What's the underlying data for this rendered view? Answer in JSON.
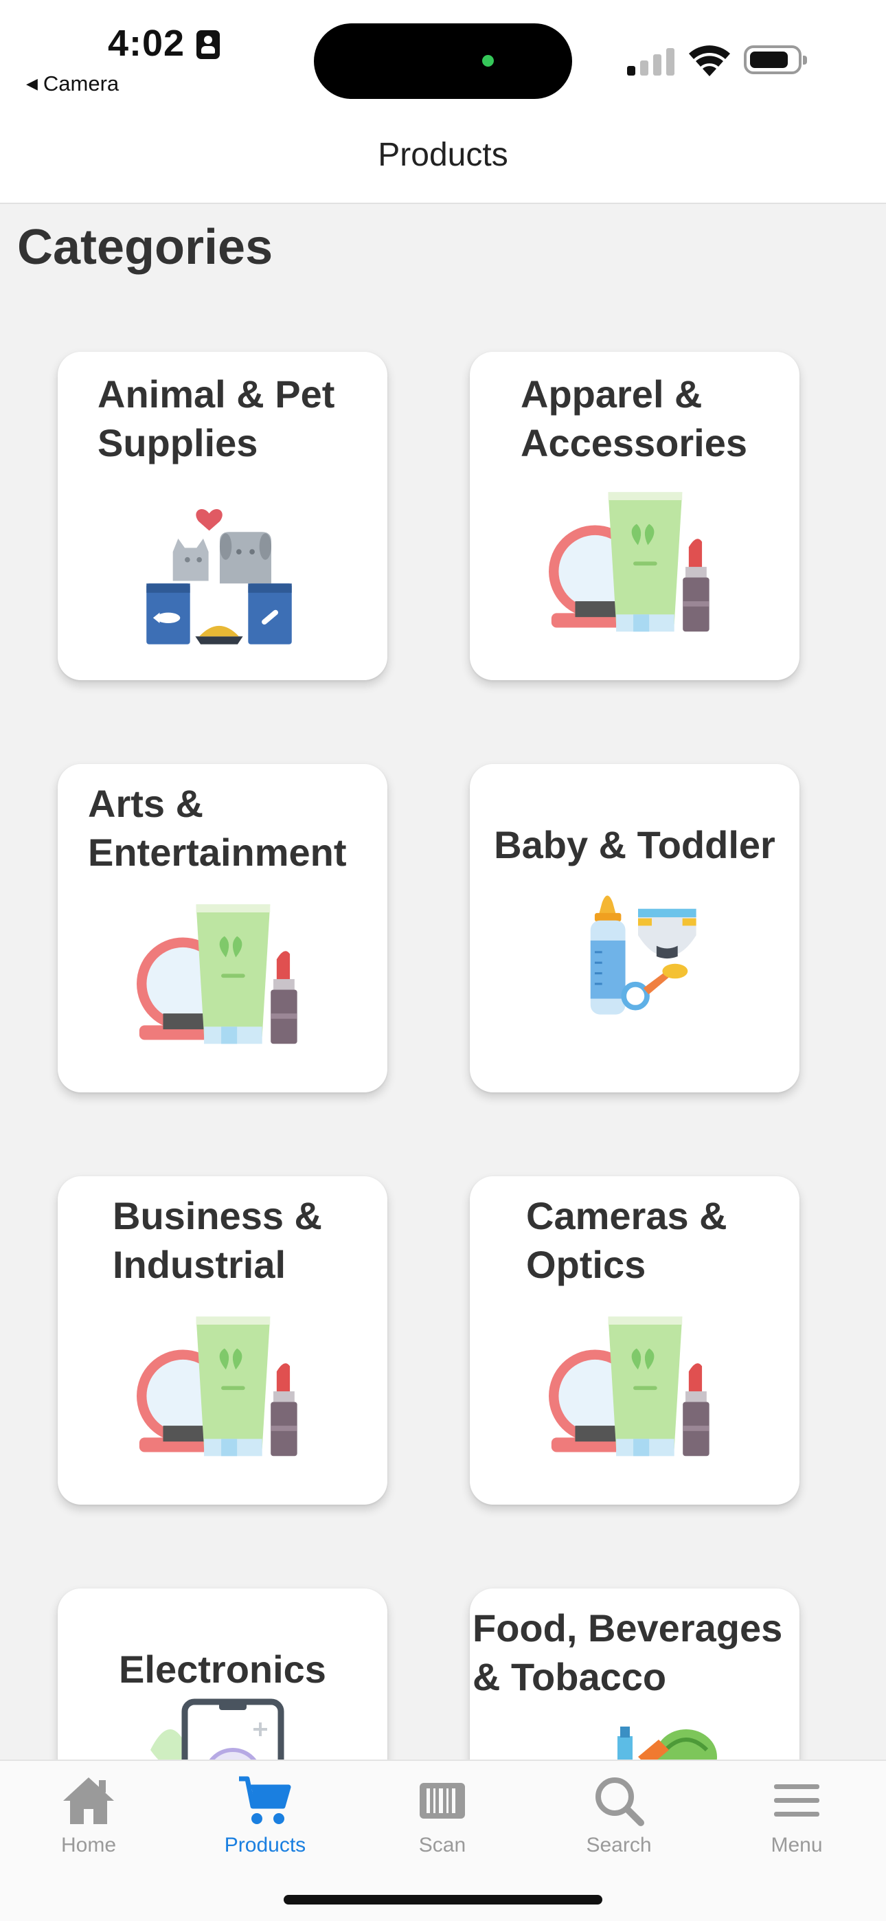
{
  "status_bar": {
    "time": "4:02",
    "back_app": "Camera"
  },
  "nav": {
    "title": "Products"
  },
  "section": {
    "title": "Categories"
  },
  "categories": [
    {
      "label": "Animal & Pet\nSupplies",
      "icon": "pet-supplies-icon"
    },
    {
      "label": "Apparel &\nAccessories",
      "icon": "cosmetics-icon"
    },
    {
      "label": "Arts &\nEntertainment",
      "icon": "cosmetics-icon"
    },
    {
      "label": "Baby & Toddler",
      "icon": "baby-items-icon"
    },
    {
      "label": "Business &\nIndustrial",
      "icon": "cosmetics-icon"
    },
    {
      "label": "Cameras &\nOptics",
      "icon": "cosmetics-icon"
    },
    {
      "label": "Electronics",
      "icon": "electronics-icon"
    },
    {
      "label": "Food, Beverages\n& Tobacco",
      "icon": "groceries-icon"
    }
  ],
  "tabs": [
    {
      "label": "Home",
      "icon": "home-icon",
      "active": false
    },
    {
      "label": "Products",
      "icon": "cart-icon",
      "active": true
    },
    {
      "label": "Scan",
      "icon": "barcode-icon",
      "active": false
    },
    {
      "label": "Search",
      "icon": "search-icon",
      "active": false
    },
    {
      "label": "Menu",
      "icon": "hamburger-menu-icon",
      "active": false
    }
  ],
  "colors": {
    "accent": "#1a7fe0",
    "inactive_tab": "#9a9a9a",
    "background": "#f2f2f2",
    "card": "#ffffff"
  }
}
